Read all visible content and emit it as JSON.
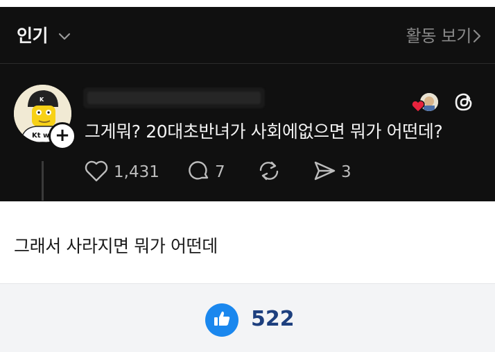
{
  "header": {
    "title": "인기",
    "activity_label": "활동 보기"
  },
  "post": {
    "text": "그게뭐? 20대초반녀가 사회에없으면 뭐가 어떤데?",
    "avatar_badge_text": "Kt wiz",
    "actions": {
      "likes": "1,431",
      "comments": "7",
      "shares": "3"
    },
    "icons": [
      "chevron-down-icon",
      "chevron-right-icon",
      "plus-icon",
      "heart-icon",
      "comment-icon",
      "repost-icon",
      "send-icon",
      "threads-logo-icon"
    ]
  },
  "comment": {
    "text": "그래서 사라지면 뭐가 어떤데"
  },
  "reaction": {
    "count": "522",
    "icon": "thumbs-up-icon"
  },
  "colors": {
    "dark_bg": "#101010",
    "light_text": "#f3f3f3",
    "muted_text": "#8a8a8a",
    "like_blue": "#1a87ee",
    "count_navy": "#1d3f7e",
    "heart_red": "#e8233d"
  }
}
